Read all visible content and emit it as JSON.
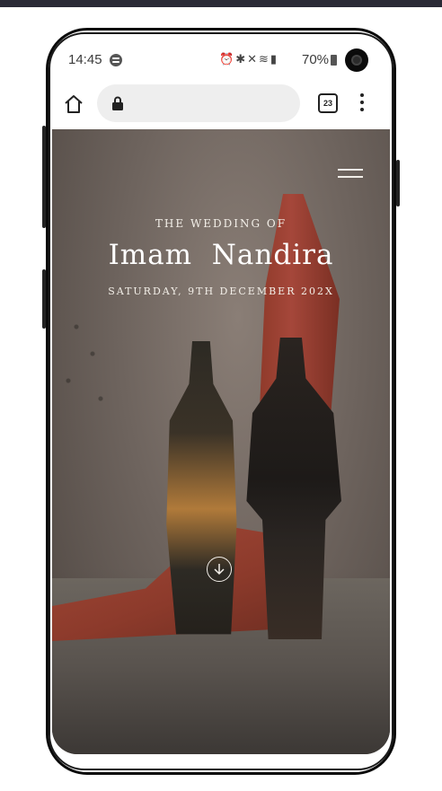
{
  "status_bar": {
    "time": "14:45",
    "battery": "70%",
    "icons": [
      "spotify-icon",
      "alarm-icon",
      "bluetooth-icon",
      "mute-icon",
      "wifi-icon",
      "signal-icon",
      "battery-icon"
    ]
  },
  "browser": {
    "tab_count": "23",
    "icons": [
      "home-icon",
      "lock-icon",
      "tabs-icon",
      "menu-icon"
    ]
  },
  "hero": {
    "kicker": "THE WEDDING OF",
    "couple_name": "Imam  Nandira",
    "date": "SATURDAY, 9TH DECEMBER 202X"
  },
  "colors": {
    "phone_frame": "#0a0a0a",
    "cloth_red": "#a5473a",
    "text_light": "#f3efe8",
    "url_field": "#eeeeee"
  }
}
